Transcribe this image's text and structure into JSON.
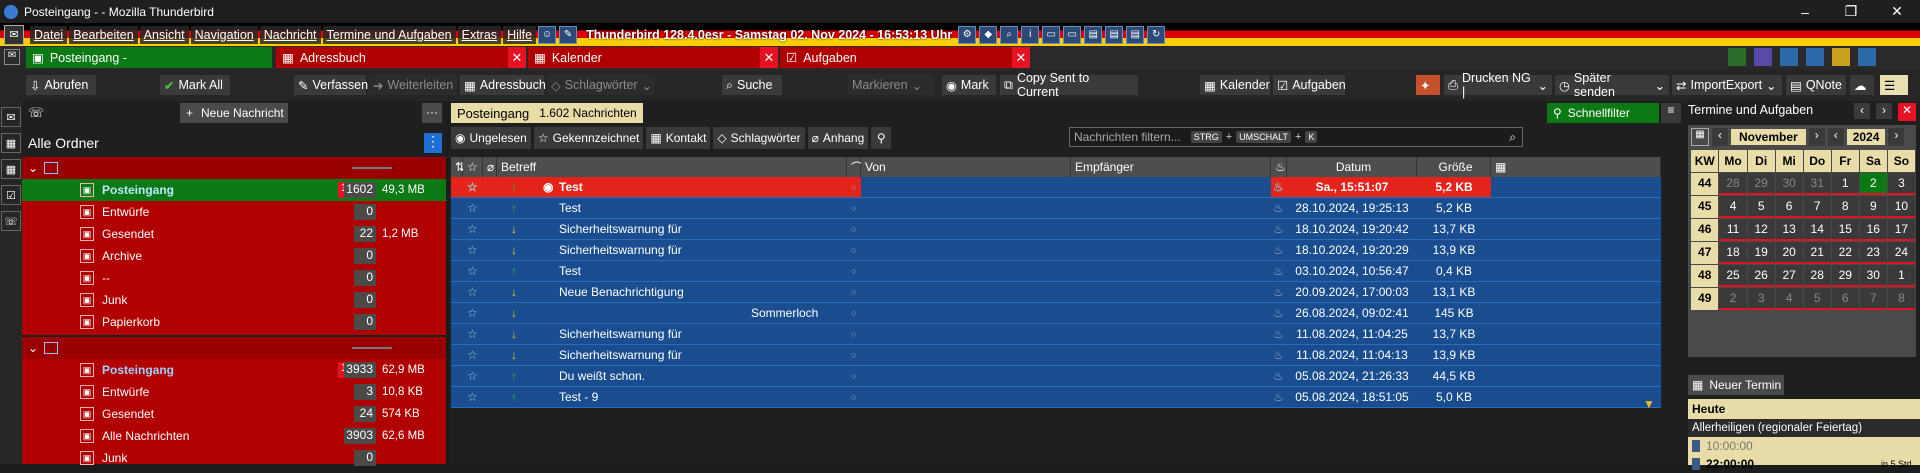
{
  "window": {
    "title": "Posteingang - - Mozilla Thunderbird",
    "minimize": "–",
    "maximize": "❐",
    "close": "✕"
  },
  "menu": [
    "Datei",
    "Bearbeiten",
    "Ansicht",
    "Navigation",
    "Nachricht",
    "Termine und Aufgaben",
    "Extras",
    "Hilfe"
  ],
  "clock": "Thunderbird 128.4.0esr - Samstag 02. Nov 2024 - 16:53:13 Uhr",
  "tabs": [
    {
      "label": "Posteingang -"
    },
    {
      "label": "Adressbuch"
    },
    {
      "label": "Kalender"
    },
    {
      "label": "Aufgaben"
    }
  ],
  "toolbar": {
    "abrufen": "Abrufen",
    "markall": "Mark All",
    "verfassen": "Verfassen",
    "weiterleiten": "Weiterleiten",
    "adressbuch": "Adressbuch",
    "schlagwoerter": "Schlagwörter",
    "suche": "Suche",
    "markieren": "Markieren",
    "mark": "Mark",
    "copysent": "Copy Sent to Current",
    "kalender": "Kalender",
    "aufgaben": "Aufgaben",
    "drucken": "Drucken NG |",
    "spaeter": "Später senden",
    "importexport": "ImportExport",
    "qnote": "QNote"
  },
  "folders": {
    "newmsg": "Neue Nachricht",
    "allfolders": "Alle Ordner",
    "acc1": [
      {
        "name": "Posteingang",
        "unread": "1",
        "count": "1602",
        "size": "49,3 MB"
      },
      {
        "name": "Entwürfe",
        "count": "0",
        "size": ""
      },
      {
        "name": "Gesendet",
        "count": "22",
        "size": "1,2 MB"
      },
      {
        "name": "Archive",
        "count": "0",
        "size": ""
      },
      {
        "name": "--",
        "count": "0",
        "size": ""
      },
      {
        "name": "Junk",
        "count": "0",
        "size": ""
      },
      {
        "name": "Papierkorb",
        "count": "0",
        "size": ""
      }
    ],
    "acc2": [
      {
        "name": "Posteingang",
        "unread": "1",
        "count": "3933",
        "size": "62,9 MB"
      },
      {
        "name": "Entwürfe",
        "count": "3",
        "size": "10,8 KB"
      },
      {
        "name": "Gesendet",
        "count": "24",
        "size": "574 KB"
      },
      {
        "name": "Alle Nachrichten",
        "count": "3903",
        "size": "62,6 MB"
      },
      {
        "name": "Junk",
        "count": "0",
        "size": ""
      }
    ]
  },
  "messages": {
    "folder": "Posteingang",
    "total": "1.602 Nachrichten",
    "quickfilter": "Schnellfilter",
    "filters": [
      "Ungelesen",
      "Gekennzeichnet",
      "Kontakt",
      "Schlagwörter",
      "Anhang"
    ],
    "search_placeholder": "Nachrichten filtern...",
    "kbd": [
      "STRG",
      "+",
      "UMSCHALT",
      "+",
      "K"
    ],
    "cols": {
      "betreff": "Betreff",
      "von": "Von",
      "empfaenger": "Empfänger",
      "datum": "Datum",
      "groesse": "Größe"
    },
    "rows": [
      {
        "subject": "Test",
        "date": "Sa., 15:51:07",
        "size": "5,2 KB",
        "sel": true,
        "arrow": "↑"
      },
      {
        "subject": "Test",
        "date": "28.10.2024, 19:25:13",
        "size": "5,2 KB",
        "arrow": "↑"
      },
      {
        "subject": "Sicherheitswarnung für",
        "date": "18.10.2024, 19:20:42",
        "size": "13,7 KB",
        "arrow": "↓"
      },
      {
        "subject": "Sicherheitswarnung für",
        "date": "18.10.2024, 19:20:29",
        "size": "13,9 KB",
        "arrow": "↓"
      },
      {
        "subject": "Test",
        "date": "03.10.2024, 10:56:47",
        "size": "0,4 KB",
        "arrow": "↑"
      },
      {
        "subject": "Neue Benachrichtigung",
        "date": "20.09.2024, 17:00:03",
        "size": "13,1 KB",
        "arrow": "↓"
      },
      {
        "subject": "Sommerloch",
        "date": "26.08.2024, 09:02:41",
        "size": "145 KB",
        "arrow": "↓",
        "center": true
      },
      {
        "subject": "Sicherheitswarnung für",
        "date": "11.08.2024, 11:04:25",
        "size": "13,7 KB",
        "arrow": "↓"
      },
      {
        "subject": "Sicherheitswarnung für",
        "date": "11.08.2024, 11:04:13",
        "size": "13,9 KB",
        "arrow": "↓"
      },
      {
        "subject": "Du weißt schon.",
        "date": "05.08.2024, 21:26:33",
        "size": "44,5 KB",
        "arrow": "↑"
      },
      {
        "subject": "Test - 9",
        "date": "05.08.2024, 18:51:05",
        "size": "5,0 KB",
        "arrow": "↑"
      }
    ]
  },
  "today": {
    "title": "Termine und Aufgaben",
    "month": "November",
    "year": "2024",
    "headers": [
      "KW",
      "Mo",
      "Di",
      "Mi",
      "Do",
      "Fr",
      "Sa",
      "So"
    ],
    "weeks": [
      [
        "44",
        "28",
        "29",
        "30",
        "31",
        "1",
        "2",
        "3"
      ],
      [
        "45",
        "4",
        "5",
        "6",
        "7",
        "8",
        "9",
        "10"
      ],
      [
        "46",
        "11",
        "12",
        "13",
        "14",
        "15",
        "16",
        "17"
      ],
      [
        "47",
        "18",
        "19",
        "20",
        "21",
        "22",
        "23",
        "24"
      ],
      [
        "48",
        "25",
        "26",
        "27",
        "28",
        "29",
        "30",
        "1"
      ],
      [
        "49",
        "2",
        "3",
        "4",
        "5",
        "6",
        "7",
        "8"
      ]
    ],
    "newevent": "Neuer Termin",
    "heute": "Heute",
    "holiday": "Allerheiligen (regionaler Feiertag)",
    "t1": "10:00:00",
    "t2": "22:00:00",
    "t2note": "in 5 Std."
  }
}
